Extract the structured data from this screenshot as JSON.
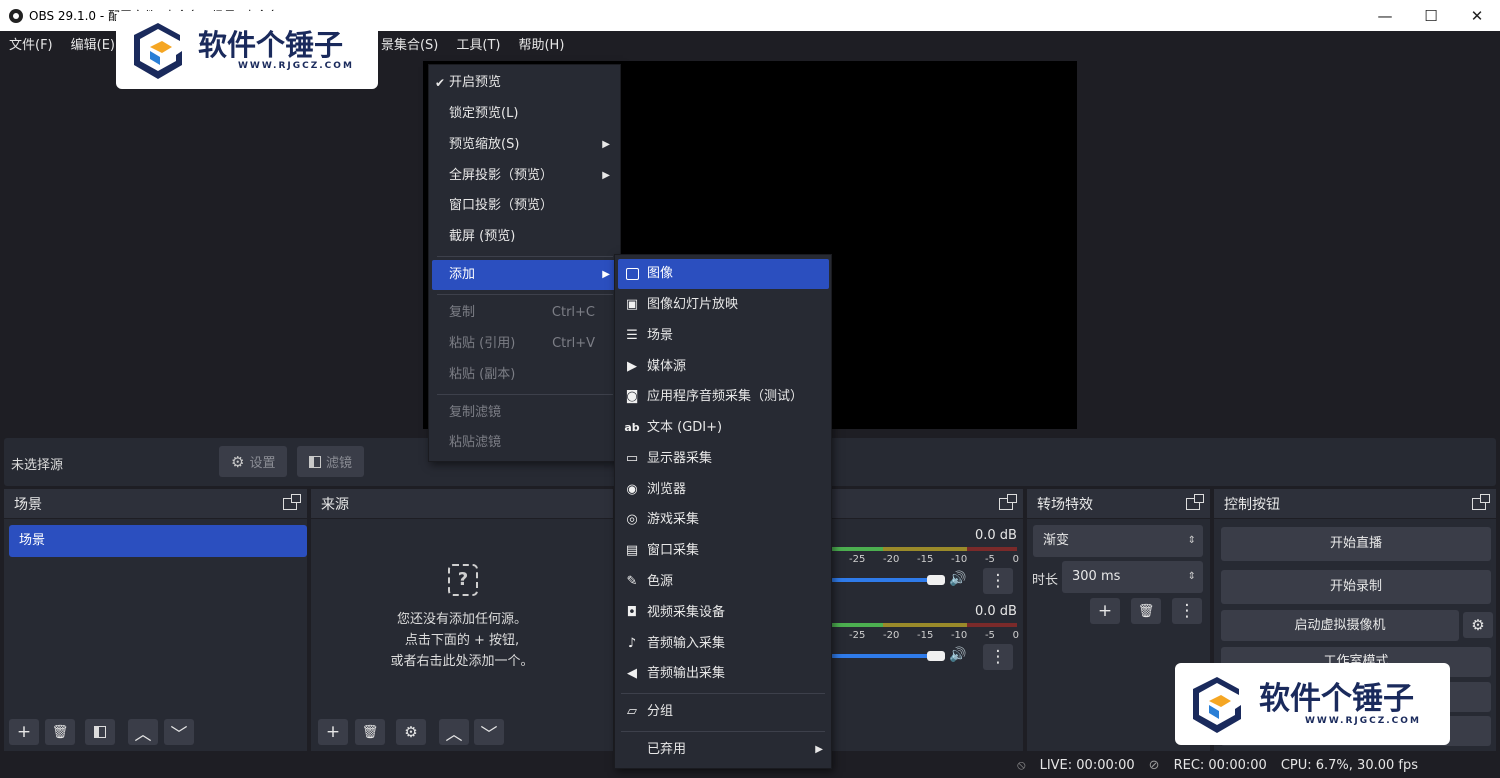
{
  "window": {
    "title": "OBS 29.1.0 - 配置文件: 未命名 - 场景: 未命名",
    "controls": {
      "minimize": "—",
      "maximize": "☐",
      "close": "✕"
    }
  },
  "menubar": {
    "items": [
      "文件(F)",
      "编辑(E)",
      "景集合(S)",
      "工具(T)",
      "帮助(H)"
    ]
  },
  "watermark": {
    "brand": "软件个锤子",
    "url": "WWW.RJGCZ.COM"
  },
  "context_menu": {
    "items": [
      {
        "label": "开启预览",
        "checked": true,
        "disabled": false
      },
      {
        "label": "锁定预览(L)",
        "disabled": false
      },
      {
        "label": "预览缩放(S)",
        "submenu": true,
        "disabled": false
      },
      {
        "label": "全屏投影（预览）",
        "submenu": true,
        "disabled": false
      },
      {
        "label": "窗口投影（预览）",
        "disabled": false
      },
      {
        "label": "截屏 (预览)",
        "disabled": false
      },
      {
        "label": "添加",
        "submenu": true,
        "highlighted": true,
        "disabled": false
      },
      {
        "label": "复制",
        "shortcut": "Ctrl+C",
        "disabled": true
      },
      {
        "label": "粘贴 (引用)",
        "shortcut": "Ctrl+V",
        "disabled": true
      },
      {
        "label": "粘贴 (副本)",
        "disabled": true
      },
      {
        "label": "复制滤镜",
        "disabled": true
      },
      {
        "label": "粘贴滤镜",
        "disabled": true
      }
    ]
  },
  "add_submenu": {
    "items": [
      {
        "label": "图像",
        "icon": "image-icon",
        "highlighted": true
      },
      {
        "label": "图像幻灯片放映",
        "icon": "slideshow-icon"
      },
      {
        "label": "场景",
        "icon": "list-icon"
      },
      {
        "label": "媒体源",
        "icon": "play-icon"
      },
      {
        "label": "应用程序音频采集（测试）",
        "icon": "app-audio-icon"
      },
      {
        "label": "文本 (GDI+)",
        "icon": "text-icon"
      },
      {
        "label": "显示器采集",
        "icon": "monitor-icon"
      },
      {
        "label": "浏览器",
        "icon": "globe-icon"
      },
      {
        "label": "游戏采集",
        "icon": "gamepad-icon"
      },
      {
        "label": "窗口采集",
        "icon": "window-icon"
      },
      {
        "label": "色源",
        "icon": "brush-icon"
      },
      {
        "label": "视频采集设备",
        "icon": "camera-icon"
      },
      {
        "label": "音频输入采集",
        "icon": "mic-icon"
      },
      {
        "label": "音频输出采集",
        "icon": "speaker-icon"
      },
      {
        "label": "分组",
        "icon": "folder-icon"
      },
      {
        "label": "已弃用",
        "submenu": true
      }
    ]
  },
  "source_toolbar": {
    "no_selection": "未选择源",
    "settings_label": "设置",
    "filters_label": "滤镜"
  },
  "docks": {
    "scenes": {
      "title": "场景",
      "items": [
        "场景"
      ]
    },
    "sources": {
      "title": "来源",
      "empty_line1": "您还没有添加任何源。",
      "empty_line2": "点击下面的 + 按钮,",
      "empty_line3": "或者右击此处添加一个。"
    },
    "mixer": {
      "channels": [
        {
          "db": "0.0 dB",
          "volume": 1.0
        },
        {
          "db": "0.0 dB",
          "volume": 1.0
        }
      ],
      "ticks": [
        "-25",
        "-20",
        "-15",
        "-10",
        "-5",
        "0"
      ]
    },
    "transitions": {
      "title": "转场特效",
      "selected": "渐变",
      "duration_label": "时长",
      "duration_value": "300 ms"
    },
    "controls": {
      "title": "控制按钮",
      "start_stream": "开始直播",
      "start_record": "开始录制",
      "virtual_cam": "启动虚拟摄像机",
      "studio_mode": "工作室模式"
    }
  },
  "statusbar": {
    "live": "LIVE: 00:00:00",
    "rec": "REC: 00:00:00",
    "cpu": "CPU: 6.7%, 30.00 fps"
  },
  "colors": {
    "accent": "#2b4fbf",
    "bg": "#1e1e24",
    "dock": "#272a33"
  }
}
